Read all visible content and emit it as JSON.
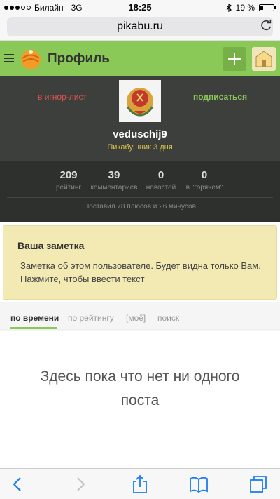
{
  "status": {
    "carrier": "Билайн",
    "network": "3G",
    "time": "18:25",
    "battery_text": "19 %",
    "battery_level": 0.19
  },
  "browser": {
    "url": "pikabu.ru"
  },
  "header": {
    "title": "Профиль"
  },
  "profile": {
    "ignore_label": "в игнор-лист",
    "subscribe_label": "подписаться",
    "username": "veduschij9",
    "rank": "Пикабушник 3 дня",
    "stats": [
      {
        "value": "209",
        "label": "рейтинг"
      },
      {
        "value": "39",
        "label": "комментариев"
      },
      {
        "value": "0",
        "label": "новостей"
      },
      {
        "value": "0",
        "label": "в \"горячем\""
      }
    ],
    "votes_text": "Поставил 78 плюсов и 26 минусов"
  },
  "note": {
    "title": "Ваша заметка",
    "text": "Заметка об этом пользователе. Будет видна только Вам. Нажмите, чтобы ввести текст"
  },
  "tabs": [
    {
      "label": "по времени"
    },
    {
      "label": "по рейтингу"
    },
    {
      "label": "[моё]"
    },
    {
      "label": "поиск"
    }
  ],
  "empty_message": "Здесь пока что нет ни одного поста",
  "colors": {
    "header_green": "#8ac858",
    "profile_bg": "#3d3f3d",
    "note_bg": "#f3e9b3",
    "ignore_red": "#d9534f"
  }
}
